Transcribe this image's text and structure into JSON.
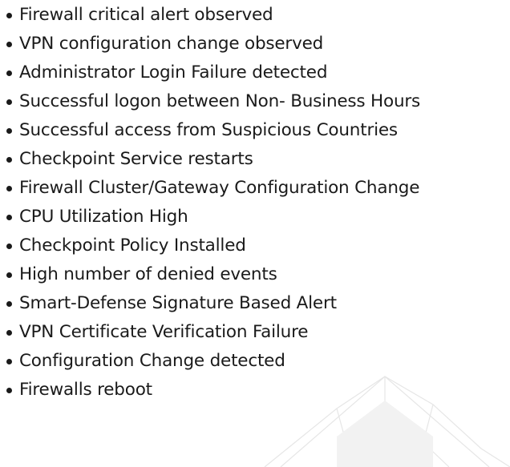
{
  "alerts": [
    "Firewall critical alert observed",
    "VPN configuration change observed",
    "Administrator Login Failure detected",
    "Successful logon between Non- Business Hours",
    "Successful access from Suspicious Countries",
    "Checkpoint Service restarts",
    "Firewall Cluster/Gateway Configuration Change",
    "CPU Utilization High",
    "Checkpoint Policy Installed",
    "High number of denied events",
    "Smart-Defense Signature Based Alert",
    "VPN Certificate Verification Failure",
    "Configuration Change detected",
    "Firewalls reboot"
  ],
  "colors": {
    "text": "#1a1a1a",
    "background": "#ffffff",
    "watermark": "#e6e6e6"
  }
}
